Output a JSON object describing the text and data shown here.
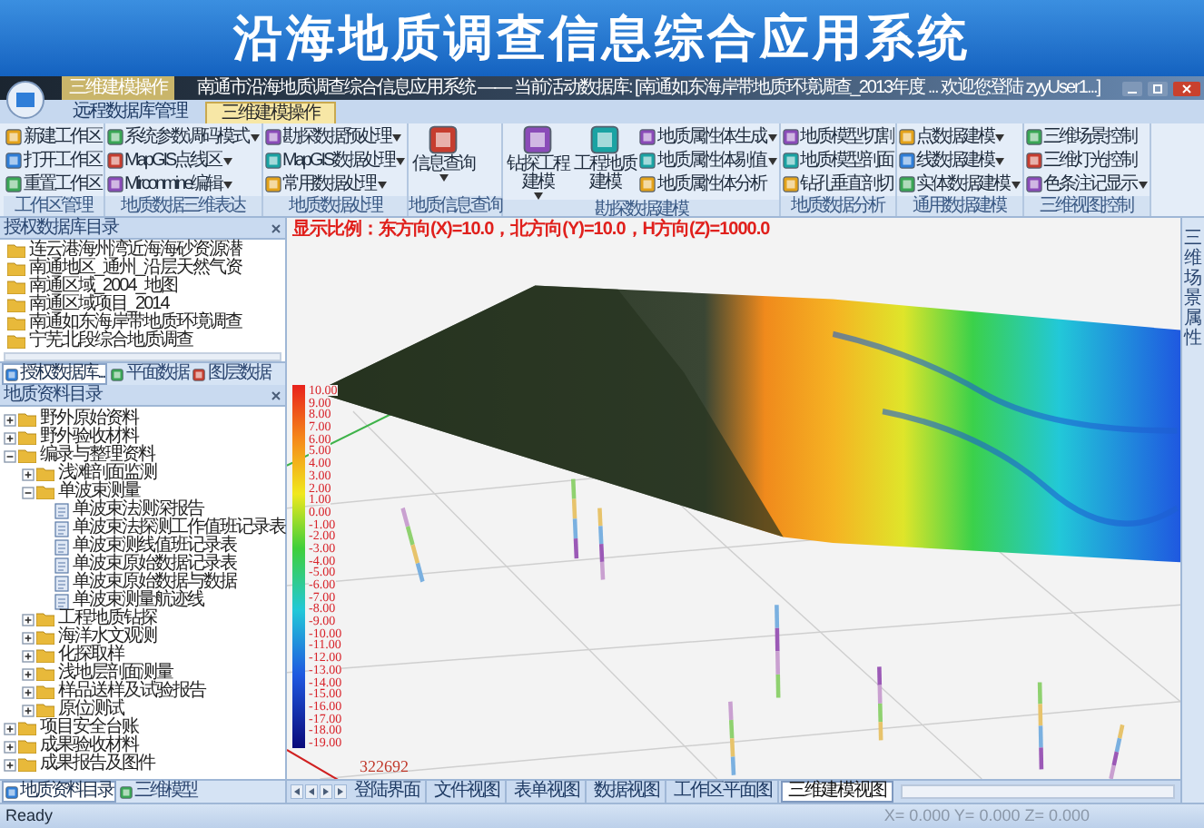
{
  "banner": {
    "title": "沿海地质调查信息综合应用系统"
  },
  "window": {
    "context_tab": "三维建模操作",
    "title": "南通市沿海地质调查综合信息应用系统 —— 当前活动数据库: [南通如东海岸带地质环境调查_2013年度 ... 欢迎您登陆 zyyUser1...]"
  },
  "ribbon_tabs": [
    {
      "label": "远程数据库管理",
      "selected": false
    },
    {
      "label": "三维建模操作",
      "selected": true
    }
  ],
  "ribbon_groups": [
    {
      "label": "工作区管理",
      "items": [
        {
          "kind": "small",
          "label": "新建工作区",
          "dropdown": false
        },
        {
          "kind": "small",
          "label": "打开工作区",
          "dropdown": false
        },
        {
          "kind": "small",
          "label": "重置工作区",
          "dropdown": false
        }
      ]
    },
    {
      "label": "地质数据三维表达",
      "items": [
        {
          "kind": "small",
          "label": "系统参数调码模式",
          "dropdown": true
        },
        {
          "kind": "small",
          "label": "MapGIS点线区",
          "dropdown": true
        },
        {
          "kind": "small",
          "label": "Mirconmine编辑",
          "dropdown": true
        }
      ]
    },
    {
      "label": "地质数据处理",
      "items": [
        {
          "kind": "small",
          "label": "勘探数据预处理",
          "dropdown": true
        },
        {
          "kind": "small",
          "label": "MapGIS数据处理",
          "dropdown": true
        },
        {
          "kind": "small",
          "label": "常用数据处理",
          "dropdown": true
        }
      ]
    },
    {
      "label": "地质信息查询",
      "items": [
        {
          "kind": "large",
          "label": "信息查询",
          "dropdown": true
        }
      ]
    },
    {
      "label": "勘探数据建模",
      "items": [
        {
          "kind": "large",
          "label": "钻探工程建模",
          "dropdown": true
        },
        {
          "kind": "large",
          "label": "工程地质建模",
          "dropdown": false
        },
        {
          "kind": "small",
          "label": "地质属性体生成",
          "dropdown": true
        },
        {
          "kind": "small",
          "label": "地质属性体剔值",
          "dropdown": true
        },
        {
          "kind": "small",
          "label": "地质属性体分析",
          "dropdown": false
        }
      ]
    },
    {
      "label": "地质数据分析",
      "items": [
        {
          "kind": "small",
          "label": "地质模型切割",
          "dropdown": false
        },
        {
          "kind": "small",
          "label": "地质模型剖面",
          "dropdown": false
        },
        {
          "kind": "small",
          "label": "钻孔垂直剖切",
          "dropdown": false
        }
      ]
    },
    {
      "label": "通用数据建模",
      "items": [
        {
          "kind": "small",
          "label": "点数据建模",
          "dropdown": true
        },
        {
          "kind": "small",
          "label": "线数据建模",
          "dropdown": true
        },
        {
          "kind": "small",
          "label": "实体数据建模",
          "dropdown": true
        }
      ]
    },
    {
      "label": "三维视图控制",
      "items": [
        {
          "kind": "small",
          "label": "三维场景控制",
          "dropdown": false
        },
        {
          "kind": "small",
          "label": "三维灯光控制",
          "dropdown": false
        },
        {
          "kind": "small",
          "label": "色条注记显示",
          "dropdown": true
        }
      ]
    }
  ],
  "database_panel": {
    "title": "授权数据库目录",
    "items": [
      "连云港海州湾近海海砂资源潜",
      "南通地区_通州_沿层天然气资",
      "南通区域_2004_地图",
      "南通区域项目_2014",
      "南通如东海岸带地质环境调查",
      "宁芜北段综合地质调查"
    ],
    "tabs": [
      {
        "label": "授权数据库...",
        "selected": true
      },
      {
        "label": "平面数据",
        "selected": false
      },
      {
        "label": "图层数据",
        "selected": false
      }
    ]
  },
  "catalog_panel": {
    "title": "地质资料目录",
    "tree": [
      {
        "kind": "folder",
        "label": "野外原始资料",
        "expanded": false
      },
      {
        "kind": "folder",
        "label": "野外验收材料",
        "expanded": false
      },
      {
        "kind": "folder",
        "label": "编录与整理资料",
        "expanded": true,
        "children": [
          {
            "kind": "folder",
            "label": "浅滩剖面监测",
            "expanded": false
          },
          {
            "kind": "folder",
            "label": "单波束测量",
            "expanded": true,
            "children": [
              {
                "kind": "file",
                "label": "单波束法测深报告"
              },
              {
                "kind": "file",
                "label": "单波束法探测工作值班记录表"
              },
              {
                "kind": "file",
                "label": "单波束测线值班记录表"
              },
              {
                "kind": "file",
                "label": "单波束原始数据记录表"
              },
              {
                "kind": "file",
                "label": "单波束原始数据与数据"
              },
              {
                "kind": "file",
                "label": "单波束测量航迹线"
              }
            ]
          },
          {
            "kind": "folder",
            "label": "工程地质钻探",
            "expanded": false
          },
          {
            "kind": "folder",
            "label": "海洋水文观测",
            "expanded": false
          },
          {
            "kind": "folder",
            "label": "化探取样",
            "expanded": false
          },
          {
            "kind": "folder",
            "label": "浅地层剖面测量",
            "expanded": false
          },
          {
            "kind": "folder",
            "label": "样品送样及试验报告",
            "expanded": false
          },
          {
            "kind": "folder",
            "label": "原位测试",
            "expanded": false
          }
        ]
      },
      {
        "kind": "folder",
        "label": "项目安全台账",
        "expanded": false
      },
      {
        "kind": "folder",
        "label": "成果验收材料",
        "expanded": false
      },
      {
        "kind": "folder",
        "label": "成果报告及图件",
        "expanded": false
      }
    ]
  },
  "left_tabs": [
    {
      "label": "地质资料目录",
      "selected": true
    },
    {
      "label": "三维模型",
      "selected": false
    }
  ],
  "view": {
    "scale_text": "显示比例：东方向(X)=10.0，北方向(Y)=10.0，H方向(Z)=1000.0",
    "legend": [
      "10.00",
      "9.00",
      "8.00",
      "7.00",
      "6.00",
      "5.00",
      "4.00",
      "3.00",
      "2.00",
      "1.00",
      "0.00",
      "-1.00",
      "-2.00",
      "-3.00",
      "-4.00",
      "-5.00",
      "-6.00",
      "-7.00",
      "-8.00",
      "-9.00",
      "-10.00",
      "-11.00",
      "-12.00",
      "-13.00",
      "-14.00",
      "-15.00",
      "-16.00",
      "-17.00",
      "-18.00",
      "-19.00"
    ],
    "axis_label": "322692"
  },
  "view_tabs": [
    {
      "label": "登陆界面",
      "selected": false
    },
    {
      "label": "文件视图",
      "selected": false
    },
    {
      "label": "表单视图",
      "selected": false
    },
    {
      "label": "数据视图",
      "selected": false
    },
    {
      "label": "工作区平面图",
      "selected": false
    },
    {
      "label": "三维建模视图",
      "selected": true
    }
  ],
  "side_tab": "三维场景属性",
  "status_bar": {
    "message": "Ready",
    "coords": "X= 0.000 Y= 0.000 Z= 0.000"
  }
}
